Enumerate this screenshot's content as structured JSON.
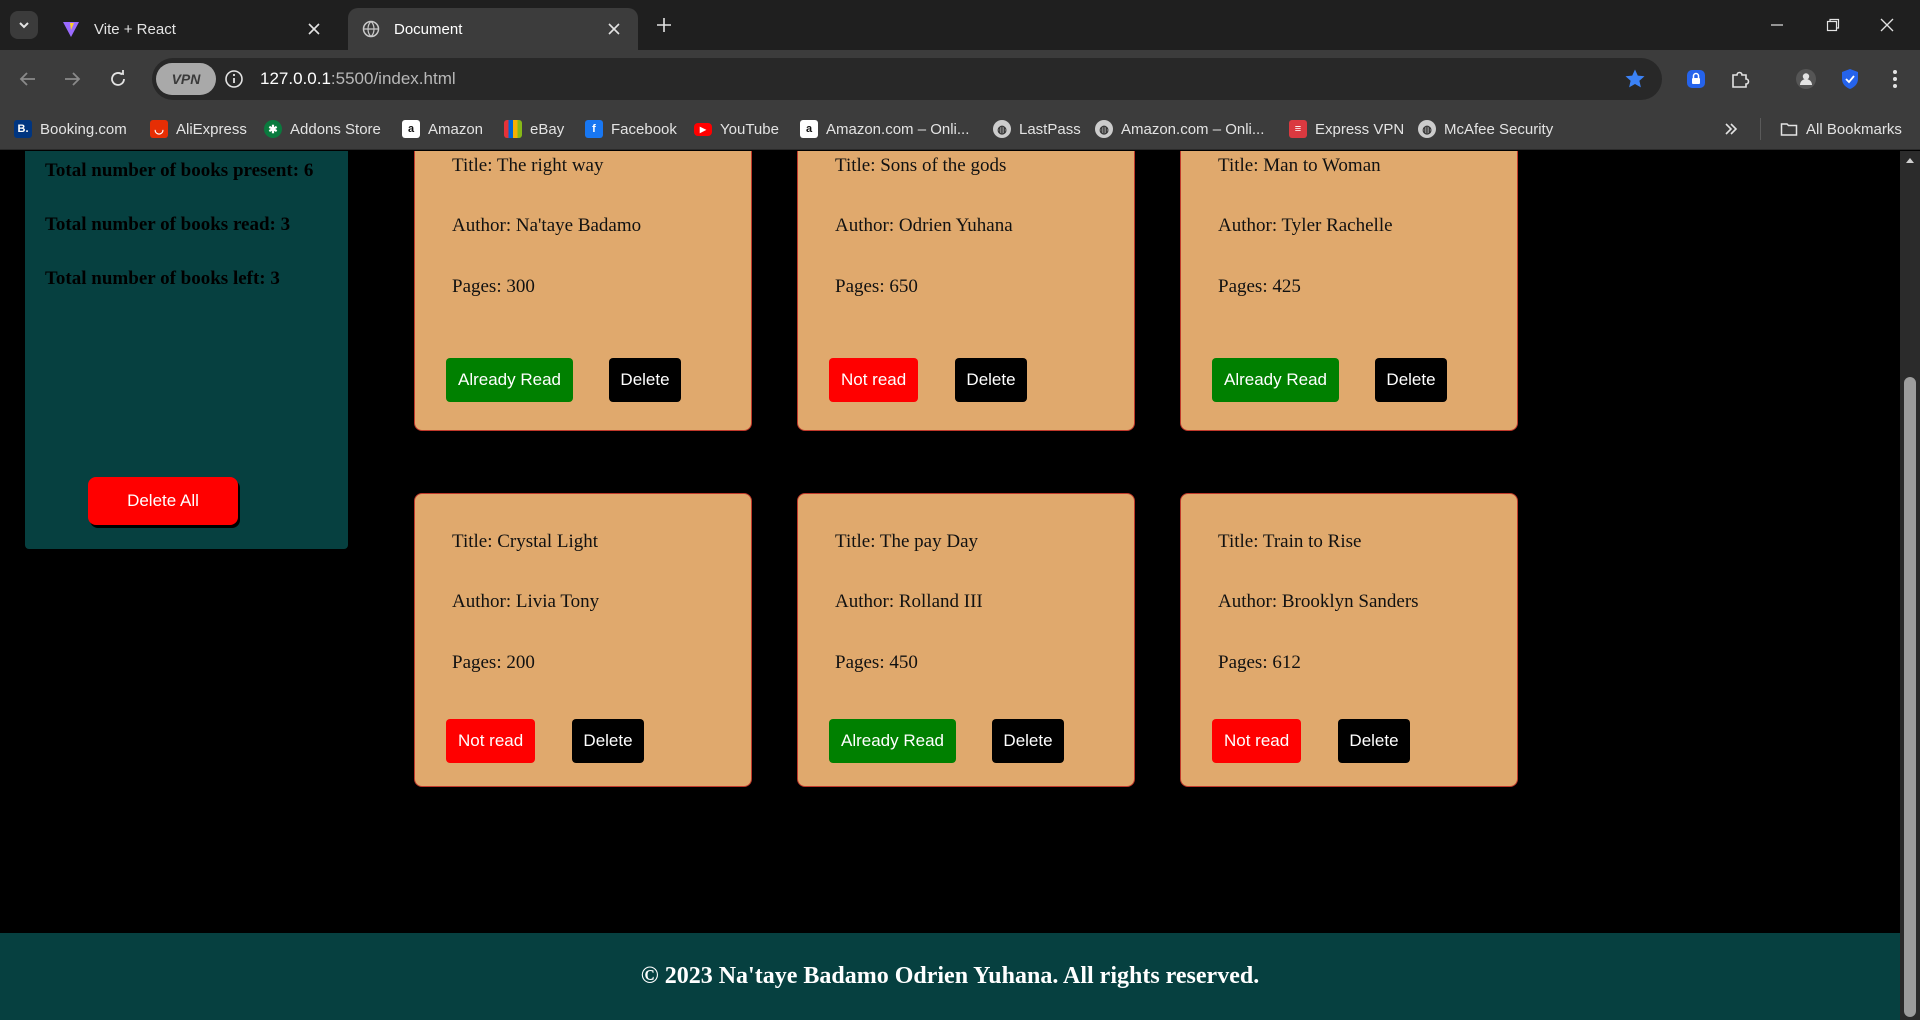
{
  "browser": {
    "tabs": [
      {
        "title": "Vite + React",
        "icon": "vite-icon",
        "active": false
      },
      {
        "title": "Document",
        "icon": "globe-icon",
        "active": true
      }
    ],
    "url_host": "127.0.0.1",
    "url_path": ":5500/index.html",
    "vpn_label": "VPN",
    "bookmarks": [
      {
        "label": "Booking.com",
        "icon": "booking-icon",
        "color": "#003580"
      },
      {
        "label": "AliExpress",
        "icon": "aliexpress-icon",
        "color": "#e62e04"
      },
      {
        "label": "Addons Store",
        "icon": "addons-icon",
        "color": "#0a7a3e"
      },
      {
        "label": "Amazon",
        "icon": "amazon-icon",
        "color": "#ffffff"
      },
      {
        "label": "eBay",
        "icon": "ebay-icon",
        "color": "#e53238"
      },
      {
        "label": "Facebook",
        "icon": "facebook-icon",
        "color": "#1877f2"
      },
      {
        "label": "YouTube",
        "icon": "youtube-icon",
        "color": "#ff0000"
      },
      {
        "label": "Amazon.com – Onli...",
        "icon": "amazon-icon",
        "color": "#ffffff"
      },
      {
        "label": "LastPass",
        "icon": "globe-icon",
        "color": "#cccccc"
      },
      {
        "label": "Amazon.com – Onli...",
        "icon": "globe-icon",
        "color": "#cccccc"
      },
      {
        "label": "Express VPN",
        "icon": "expressvpn-icon",
        "color": "#da3940"
      },
      {
        "label": "McAfee Security",
        "icon": "globe-icon",
        "color": "#cccccc"
      }
    ],
    "all_bookmarks": "All Bookmarks"
  },
  "stats": {
    "present": "Total number of books present: 6",
    "read": "Total number of books read: 3",
    "left": "Total number of books left: 3",
    "delete_all": "Delete All"
  },
  "books": [
    {
      "title": "Title: The right way",
      "author": "Author: Na'taye Badamo",
      "pages": "Pages: 300",
      "status": "Already Read",
      "read": true,
      "delete": "Delete"
    },
    {
      "title": "Title: Sons of the gods",
      "author": "Author: Odrien Yuhana",
      "pages": "Pages: 650",
      "status": "Not read",
      "read": false,
      "delete": "Delete"
    },
    {
      "title": "Title: Man to Woman",
      "author": "Author: Tyler Rachelle",
      "pages": "Pages: 425",
      "status": "Already Read",
      "read": true,
      "delete": "Delete"
    },
    {
      "title": "Title: Crystal Light",
      "author": "Author: Livia Tony",
      "pages": "Pages: 200",
      "status": "Not read",
      "read": false,
      "delete": "Delete"
    },
    {
      "title": "Title: The pay Day",
      "author": "Author: Rolland III",
      "pages": "Pages: 450",
      "status": "Already Read",
      "read": true,
      "delete": "Delete"
    },
    {
      "title": "Title: Train to Rise",
      "author": "Author: Brooklyn Sanders",
      "pages": "Pages: 612",
      "status": "Not read",
      "read": false,
      "delete": "Delete"
    }
  ],
  "colors": {
    "read": "#008000",
    "not_read": "#ff0000",
    "panel": "#064040",
    "card": "#e0a96d"
  },
  "footer": "© 2023 Na'taye Badamo Odrien Yuhana. All rights reserved."
}
